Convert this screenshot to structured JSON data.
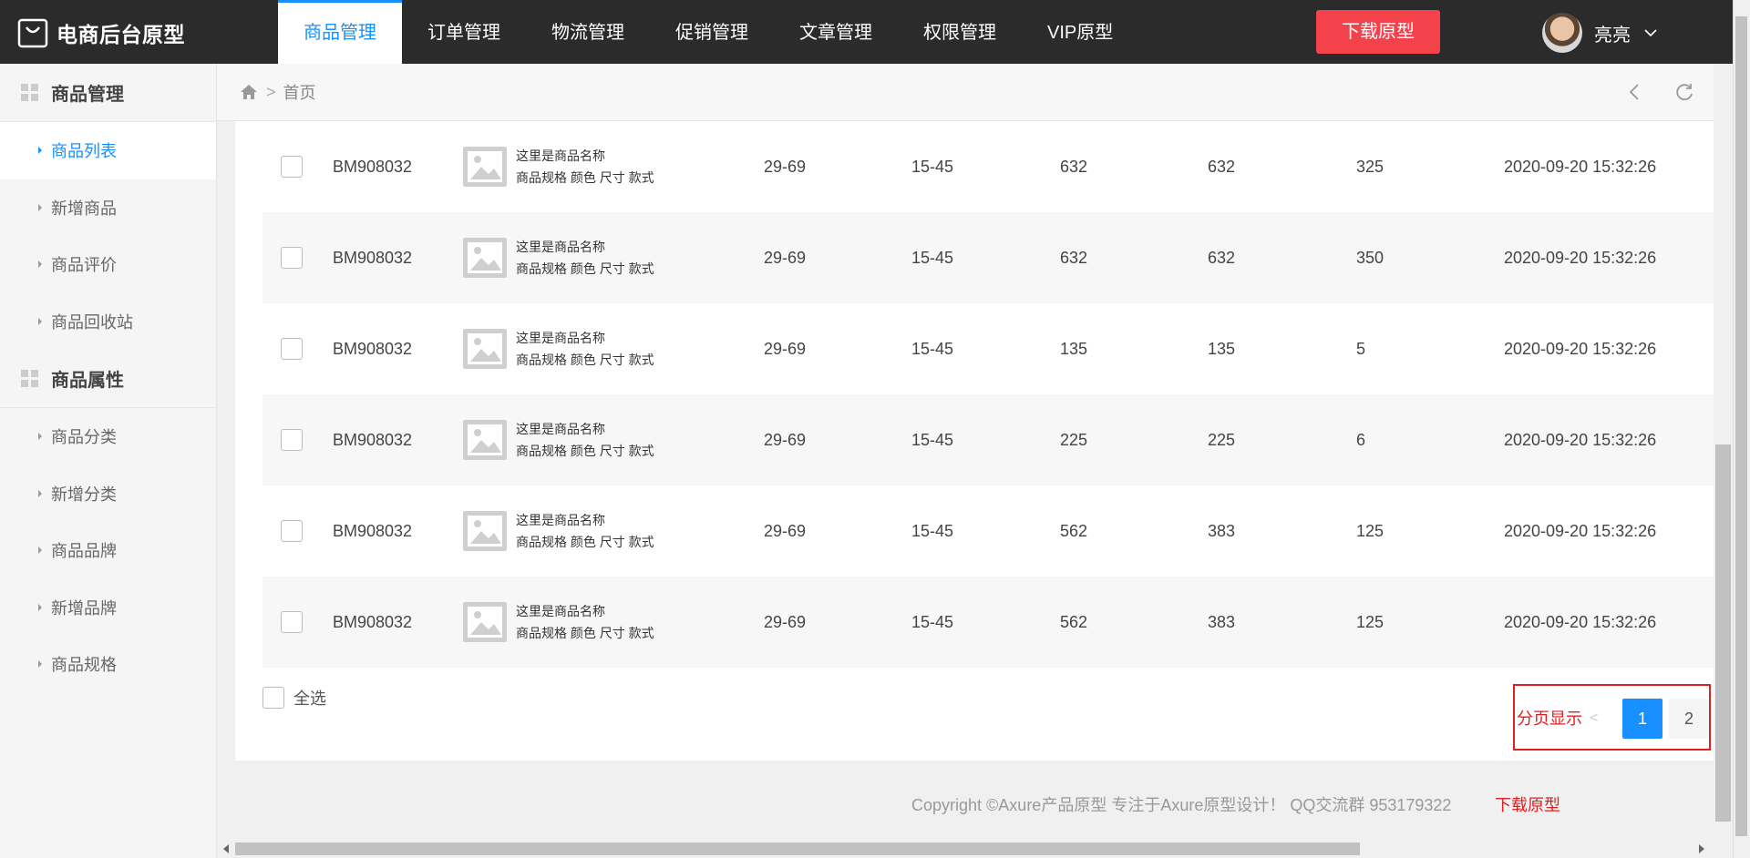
{
  "brand": {
    "title": "电商后台原型"
  },
  "nav": {
    "items": [
      {
        "label": "商品管理",
        "active": true
      },
      {
        "label": "订单管理"
      },
      {
        "label": "物流管理"
      },
      {
        "label": "促销管理"
      },
      {
        "label": "文章管理"
      },
      {
        "label": "权限管理"
      },
      {
        "label": "VIP原型"
      }
    ],
    "download_label": "下载原型",
    "user_name": "亮亮"
  },
  "sidebar": {
    "groups": [
      {
        "title": "商品管理",
        "items": [
          "商品列表",
          "新增商品",
          "商品评价",
          "商品回收站"
        ]
      },
      {
        "title": "商品属性",
        "items": [
          "商品分类",
          "新增分类",
          "商品品牌",
          "新增品牌",
          "商品规格"
        ]
      }
    ],
    "active_item": "商品列表"
  },
  "breadcrumb": {
    "home": "首页"
  },
  "table": {
    "rows": [
      {
        "code": "BM908032",
        "name": "这里是商品名称",
        "spec": "商品规格 颜色 尺寸 款式",
        "price": "29-69",
        "range": "15-45",
        "stock": "632",
        "available": "632",
        "sales": "325",
        "time": "2020-09-20 15:32:26"
      },
      {
        "code": "BM908032",
        "name": "这里是商品名称",
        "spec": "商品规格 颜色 尺寸 款式",
        "price": "29-69",
        "range": "15-45",
        "stock": "632",
        "available": "632",
        "sales": "350",
        "time": "2020-09-20 15:32:26"
      },
      {
        "code": "BM908032",
        "name": "这里是商品名称",
        "spec": "商品规格 颜色 尺寸 款式",
        "price": "29-69",
        "range": "15-45",
        "stock": "135",
        "available": "135",
        "sales": "5",
        "time": "2020-09-20 15:32:26"
      },
      {
        "code": "BM908032",
        "name": "这里是商品名称",
        "spec": "商品规格 颜色 尺寸 款式",
        "price": "29-69",
        "range": "15-45",
        "stock": "225",
        "available": "225",
        "sales": "6",
        "time": "2020-09-20 15:32:26"
      },
      {
        "code": "BM908032",
        "name": "这里是商品名称",
        "spec": "商品规格 颜色 尺寸 款式",
        "price": "29-69",
        "range": "15-45",
        "stock": "562",
        "available": "383",
        "sales": "125",
        "time": "2020-09-20 15:32:26"
      },
      {
        "code": "BM908032",
        "name": "这里是商品名称",
        "spec": "商品规格 颜色 尺寸 款式",
        "price": "29-69",
        "range": "15-45",
        "stock": "562",
        "available": "383",
        "sales": "125",
        "time": "2020-09-20 15:32:26"
      }
    ],
    "select_all": "全选"
  },
  "pager": {
    "note": "分页显示",
    "prev": "<",
    "pages": [
      "1",
      "2"
    ],
    "current": "1"
  },
  "footer": {
    "copyright": "Copyright ©Axure产品原型 专注于Axure原型设计！ QQ交流群 953179322",
    "download": "下载原型"
  },
  "colors": {
    "accent": "#1890ff",
    "danger": "#f4424d",
    "topbar": "#2b2b2b"
  }
}
